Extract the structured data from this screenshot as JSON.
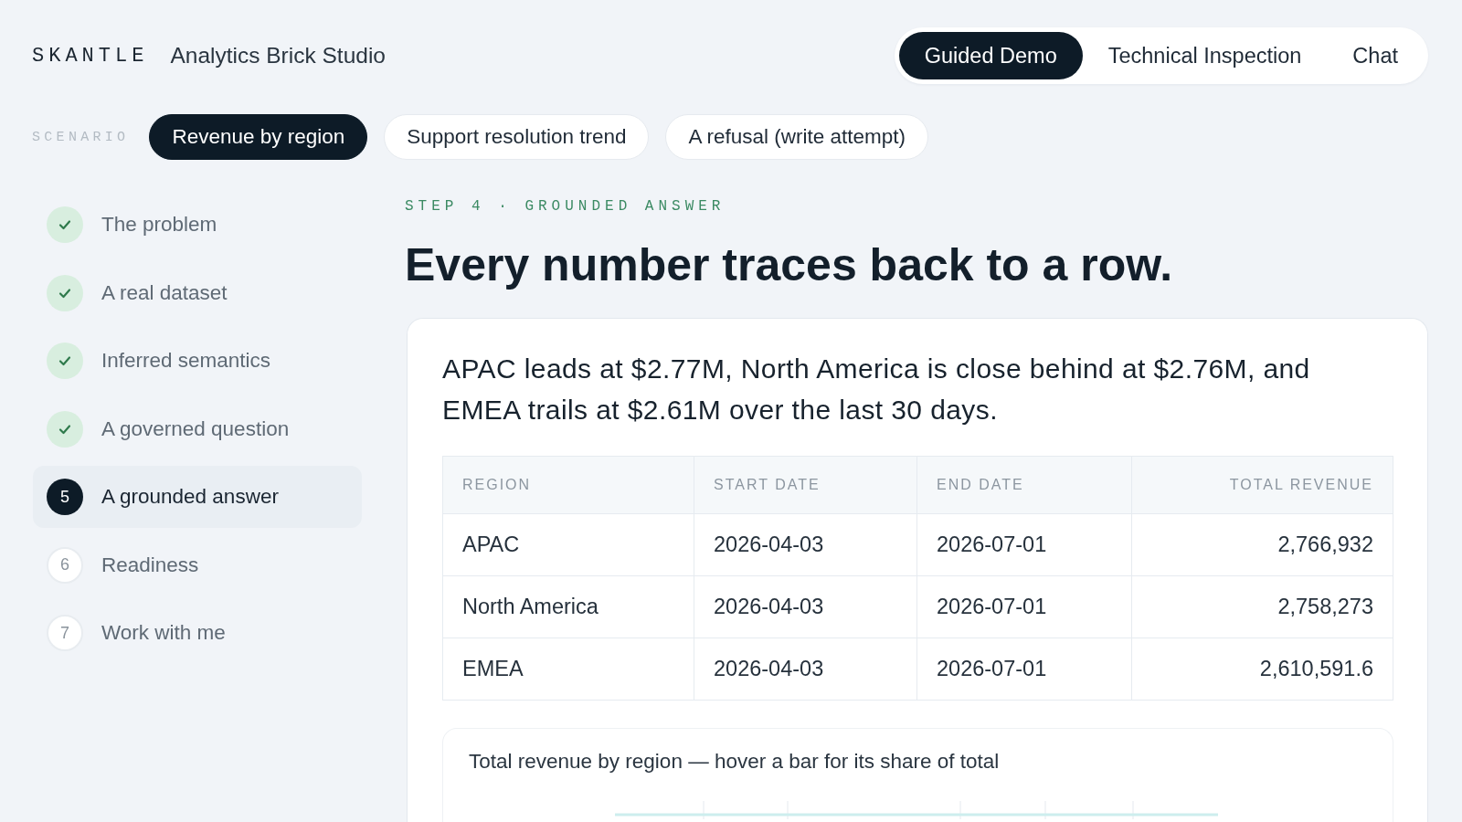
{
  "brand": {
    "logo": "SKANTLE",
    "product": "Analytics Brick Studio"
  },
  "modes": [
    {
      "label": "Guided Demo",
      "selected": true
    },
    {
      "label": "Technical Inspection",
      "selected": false
    },
    {
      "label": "Chat",
      "selected": false
    }
  ],
  "scenario": {
    "label": "SCENARIO",
    "options": [
      {
        "label": "Revenue by region",
        "selected": true
      },
      {
        "label": "Support resolution trend",
        "selected": false
      },
      {
        "label": "A refusal (write attempt)",
        "selected": false
      }
    ]
  },
  "steps": [
    {
      "label": "The problem",
      "kind": "done"
    },
    {
      "label": "A real dataset",
      "kind": "done"
    },
    {
      "label": "Inferred semantics",
      "kind": "done"
    },
    {
      "label": "A governed question",
      "kind": "done"
    },
    {
      "number": "5",
      "label": "A grounded answer",
      "kind": "current"
    },
    {
      "number": "6",
      "label": "Readiness",
      "kind": "pending"
    },
    {
      "number": "7",
      "label": "Work with me",
      "kind": "pending"
    }
  ],
  "step": {
    "eyebrow": "STEP 4 · GROUNDED ANSWER",
    "heading": "Every number traces back to a row."
  },
  "answer": {
    "summary": "APAC leads at $2.77M, North America is close behind at $2.76M, and EMEA trails at $2.61M over the last 30 days.",
    "table": {
      "columns": [
        "REGION",
        "START DATE",
        "END DATE",
        "TOTAL REVENUE"
      ],
      "rows": [
        [
          "APAC",
          "2026-04-03",
          "2026-07-01",
          "2,766,932"
        ],
        [
          "North America",
          "2026-04-03",
          "2026-07-01",
          "2,758,273"
        ],
        [
          "EMEA",
          "2026-04-03",
          "2026-07-01",
          "2,610,591.6"
        ]
      ]
    },
    "chart": {
      "title": "Total revenue by region — hover a bar for its share of total"
    }
  }
}
